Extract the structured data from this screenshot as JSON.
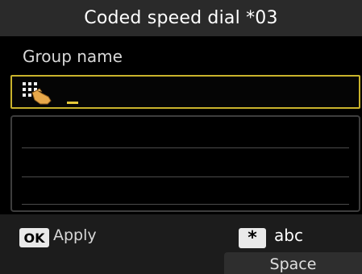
{
  "header": {
    "title": "Coded speed dial *03"
  },
  "field": {
    "label": "Group name",
    "value": ""
  },
  "icons": {
    "input_mode": "keypad-hand-icon"
  },
  "softkeys": {
    "ok": {
      "key": "OK",
      "label": "Apply"
    },
    "star": {
      "key": "*",
      "label": "abc"
    },
    "space": {
      "label": "Space"
    }
  },
  "colors": {
    "title_bar": "#2a2a2a",
    "input_border": "#c9b32c",
    "caret": "#e6c93a",
    "background": "#000000"
  }
}
